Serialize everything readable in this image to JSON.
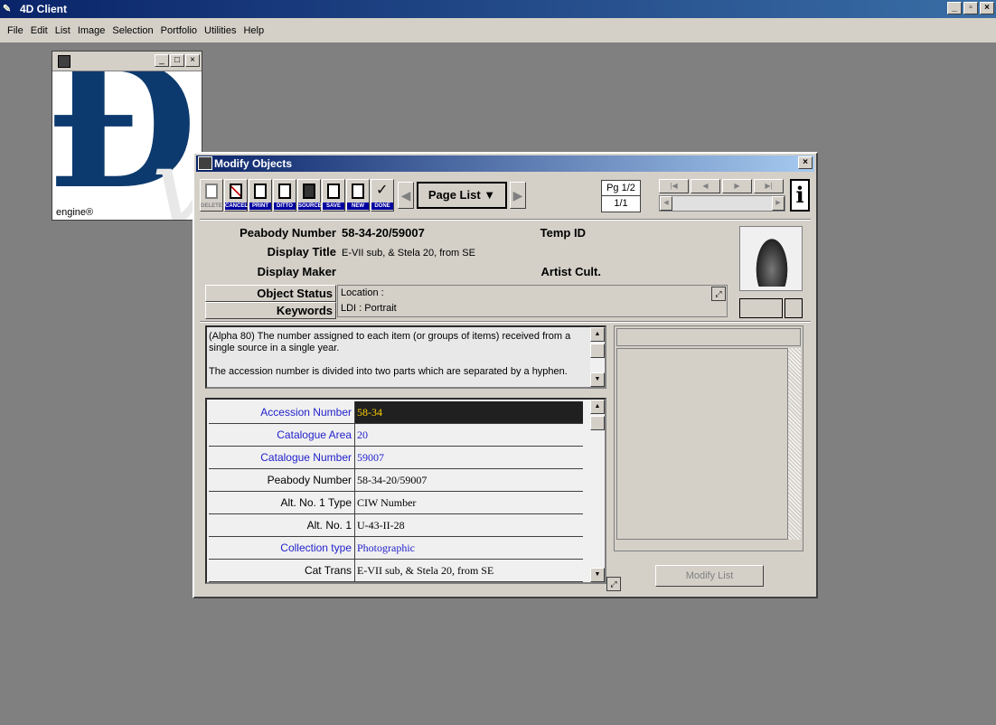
{
  "app": {
    "title": "4D Client"
  },
  "menu": [
    "File",
    "Edit",
    "List",
    "Image",
    "Selection",
    "Portfolio",
    "Utilities",
    "Help"
  ],
  "logo": {
    "trademark": "engine®"
  },
  "dialog": {
    "title": "Modify Objects",
    "toolbar": {
      "delete": "DELETE",
      "cancel": "CANCEL",
      "print": "PRINT",
      "ditto": "DITTO",
      "source": "SOURCE",
      "save": "SAVE",
      "new": "NEW",
      "done": "DONE",
      "page_list": "Page List ▼",
      "page": "Pg 1/2",
      "record": "1/1",
      "info": "i"
    },
    "header": {
      "peabody_label": "Peabody Number",
      "peabody_value": "58-34-20/59007",
      "temp_id_label": "Temp ID",
      "display_title_label": "Display Title",
      "display_title_value": "E-VII sub, & Stela 20, from SE",
      "display_maker_label": "Display Maker",
      "artist_cult_label": "Artist Cult.",
      "object_status_label": "Object Status",
      "keywords_label": "Keywords",
      "location": "Location :",
      "keywords_value": "LDI : Portrait"
    },
    "help_text": {
      "line1": "(Alpha 80) The number assigned to each item (or groups of items) received from a single source in a single year.",
      "line2": "The accession number is divided into two parts which are separated by a hyphen."
    },
    "fields": [
      {
        "label": "Accession Number",
        "value": "58-34"
      },
      {
        "label": "Catalogue Area",
        "value": "20"
      },
      {
        "label": "Catalogue Number",
        "value": "59007"
      },
      {
        "label": "Peabody Number",
        "value": "58-34-20/59007"
      },
      {
        "label": "Alt. No. 1 Type",
        "value": "CIW Number"
      },
      {
        "label": "Alt. No. 1",
        "value": "U-43-II-28"
      },
      {
        "label": "Collection type",
        "value": "Photographic"
      },
      {
        "label": "Cat Trans",
        "value": "E-VII sub, & Stela 20, from SE"
      }
    ],
    "modify_list": "Modify List"
  },
  "colors": {
    "title_bar": "#0a246a",
    "link_label": "#2222cc",
    "selected_bg": "#202020",
    "selected_fg": "#ffd000"
  }
}
